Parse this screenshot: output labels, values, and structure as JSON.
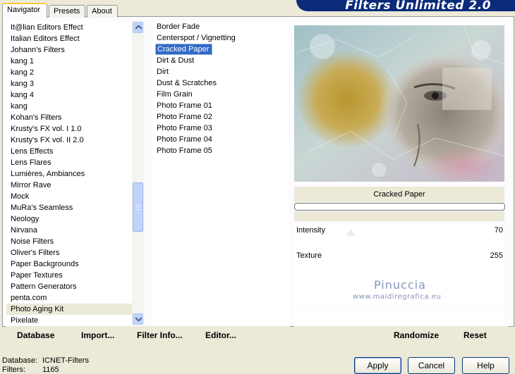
{
  "window": {
    "title": "Filters Unlimited 2.0"
  },
  "tabs": [
    {
      "label": "Navigator",
      "active": true
    },
    {
      "label": "Presets",
      "active": false
    },
    {
      "label": "About",
      "active": false
    }
  ],
  "categories": {
    "items": [
      "It@lian Editors Effect",
      "Italian Editors Effect",
      "Johann's Filters",
      "kang 1",
      "kang 2",
      "kang 3",
      "kang 4",
      "kang",
      "Kohan's Filters",
      "Krusty's FX vol. I 1.0",
      "Krusty's FX vol. II 2.0",
      "Lens Effects",
      "Lens Flares",
      "Lumières, Ambiances",
      "Mirror Rave",
      "Mock",
      "MuRa's Seamless",
      "Neology",
      "Nirvana",
      "Noise Filters",
      "Oliver's Filters",
      "Paper Backgrounds",
      "Paper Textures",
      "Pattern Generators",
      "penta.com",
      "Photo Aging Kit",
      "Pixelate"
    ],
    "selected": "Photo Aging Kit"
  },
  "filters": {
    "items": [
      "Border Fade",
      "Centerspot / Vignetting",
      "Cracked Paper",
      "Dirt & Dust",
      "Dirt",
      "Dust & Scratches",
      "Film Grain",
      "Photo Frame 01",
      "Photo Frame 02",
      "Photo Frame 03",
      "Photo Frame 04",
      "Photo Frame 05"
    ],
    "selected": "Cracked Paper"
  },
  "left_toolbar": {
    "database": "Database",
    "import": "Import...",
    "filter_info": "Filter Info...",
    "editor": "Editor..."
  },
  "preview": {
    "filter_name": "Cracked Paper"
  },
  "params": [
    {
      "label": "Intensity",
      "value": "70"
    },
    {
      "label": "Texture",
      "value": "255"
    }
  ],
  "watermark": {
    "name": "Pinuccia",
    "site": "www.maidiregrafica.eu"
  },
  "right_toolbar": {
    "randomize": "Randomize",
    "reset": "Reset"
  },
  "footer": {
    "database_label": "Database:",
    "database_value": "ICNET-Filters",
    "filters_label": "Filters:",
    "filters_value": "1165"
  },
  "buttons": {
    "apply": "Apply",
    "cancel": "Cancel",
    "help": "Help"
  },
  "colors": {
    "selection": "#316ac5",
    "banner": "#0a2a7a",
    "dialog_bg": "#ece9d8"
  }
}
